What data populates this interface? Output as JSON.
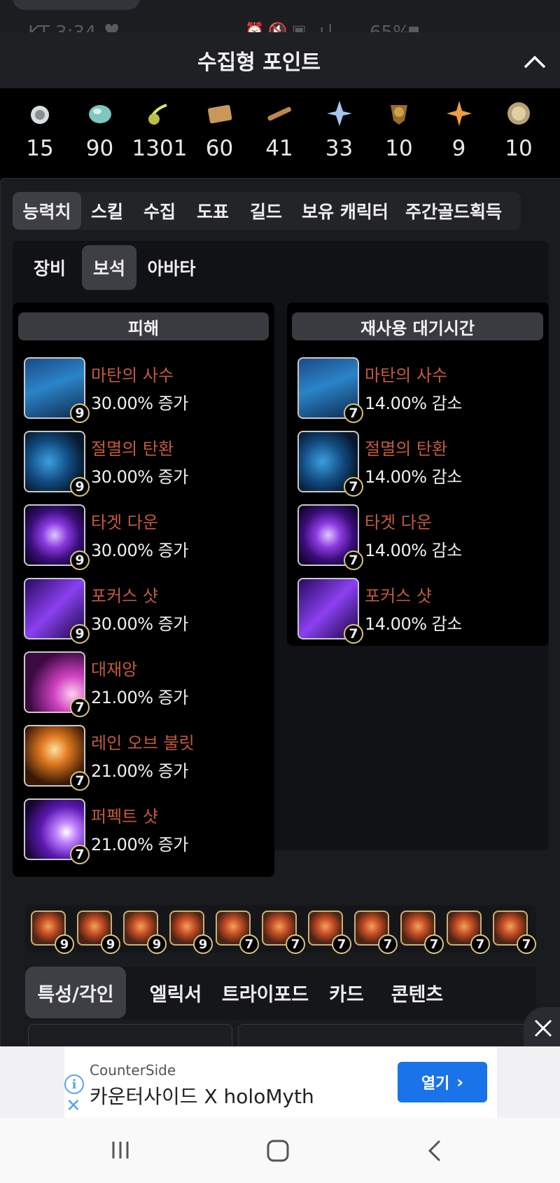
{
  "status_bar": {
    "carrier_time": "KT 3:34",
    "battery": "65%"
  },
  "header": {
    "title": "수집형 포인트"
  },
  "collectibles": [
    {
      "icon": "mokoko-seed-icon",
      "count": "15"
    },
    {
      "icon": "island-heart-icon",
      "count": "90"
    },
    {
      "icon": "giant-heart-icon",
      "count": "1301"
    },
    {
      "icon": "ignea-token-icon",
      "count": "60"
    },
    {
      "icon": "sea-bounty-icon",
      "count": "41"
    },
    {
      "icon": "world-tree-leaf-icon",
      "count": "33"
    },
    {
      "icon": "orpheus-star-icon",
      "count": "10"
    },
    {
      "icon": "masterpiece-icon",
      "count": "9"
    },
    {
      "icon": "medal-icon",
      "count": "10"
    }
  ],
  "main_tabs": [
    "능력치",
    "스킬",
    "수집",
    "도표",
    "길드",
    "보유 캐릭터",
    "주간골드획득"
  ],
  "sub_tabs": [
    "장비",
    "보석",
    "아바타"
  ],
  "damage": {
    "header": "피해",
    "gems": [
      {
        "name": "마탄의 사수",
        "value": "30.00% 증가",
        "level": "9",
        "icon": "gunner-icon"
      },
      {
        "name": "절멸의 탄환",
        "value": "30.00% 증가",
        "level": "9",
        "icon": "bullet-icon"
      },
      {
        "name": "타겟 다운",
        "value": "30.00% 증가",
        "level": "9",
        "icon": "target-icon"
      },
      {
        "name": "포커스 샷",
        "value": "30.00% 증가",
        "level": "9",
        "icon": "focus-shot-icon"
      },
      {
        "name": "대재앙",
        "value": "21.00% 증가",
        "level": "7",
        "icon": "catastrophe-icon"
      },
      {
        "name": "레인 오브 불릿",
        "value": "21.00% 증가",
        "level": "7",
        "icon": "rain-of-bullets-icon"
      },
      {
        "name": "퍼펙트 샷",
        "value": "21.00% 증가",
        "level": "7",
        "icon": "perfect-shot-icon"
      }
    ]
  },
  "cooldown": {
    "header": "재사용 대기시간",
    "gems": [
      {
        "name": "마탄의 사수",
        "value": "14.00% 감소",
        "level": "7",
        "icon": "gunner-icon"
      },
      {
        "name": "절멸의 탄환",
        "value": "14.00% 감소",
        "level": "7",
        "icon": "bullet-icon"
      },
      {
        "name": "타겟 다운",
        "value": "14.00% 감소",
        "level": "7",
        "icon": "target-icon"
      },
      {
        "name": "포커스 샷",
        "value": "14.00% 감소",
        "level": "7",
        "icon": "focus-shot-icon"
      }
    ]
  },
  "gem_strip": [
    "9",
    "9",
    "9",
    "9",
    "7",
    "7",
    "7",
    "7",
    "7",
    "7",
    "7"
  ],
  "bottom_tabs": [
    "특성/각인",
    "엘릭서",
    "트라이포드",
    "카드",
    "콘텐츠"
  ],
  "ad": {
    "brand": "CounterSide",
    "title": "카운터사이드 X holoMyth",
    "cta": "열기"
  },
  "colors": {
    "skill_name": "#c25a3e",
    "ad_button": "#1a73e8",
    "gem_frame": "#d8c47a"
  }
}
